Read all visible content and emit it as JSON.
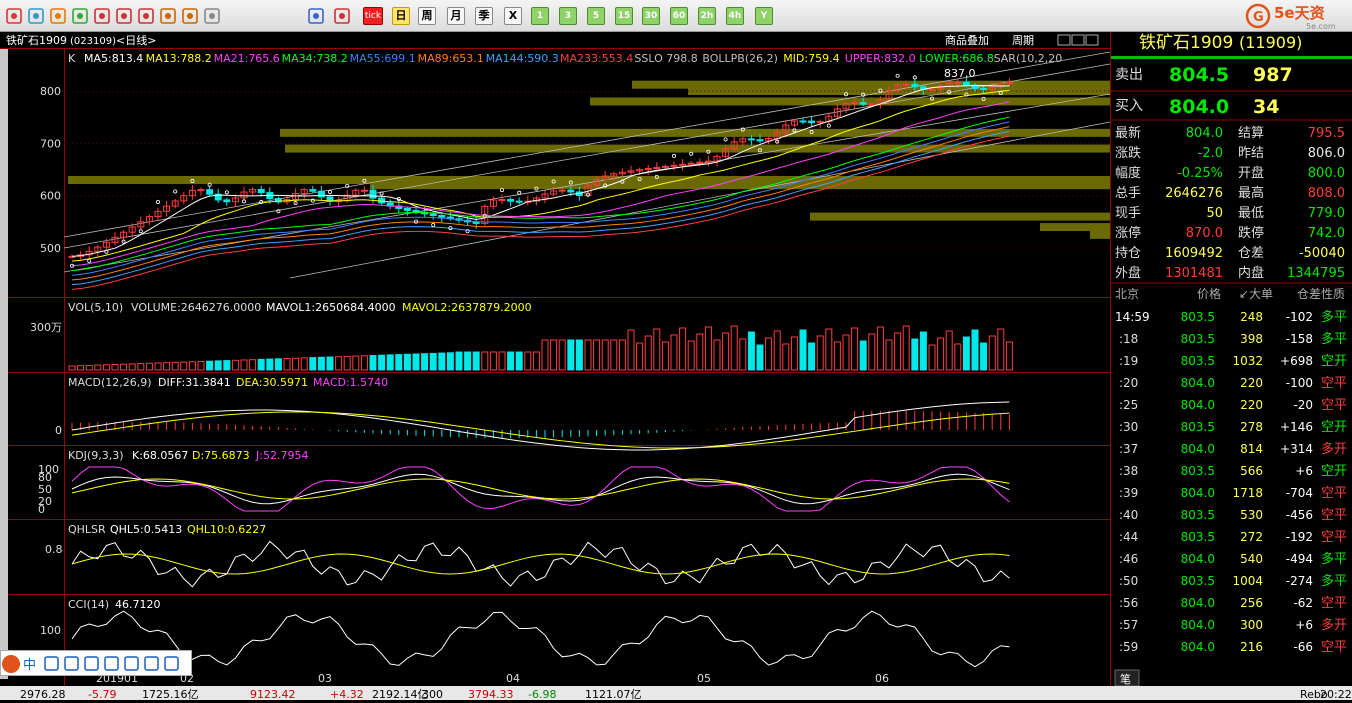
{
  "toolbar": {
    "buttons": [
      "home-icon",
      "save-icon",
      "f10-icon",
      "refresh-icon",
      "zoom-in-icon",
      "zoom-out-icon",
      "window-icon",
      "pen-icon",
      "tool-icon",
      "filter-icon",
      "table-icon",
      "chart-icon"
    ],
    "tick": "tick",
    "periods": [
      "日",
      "周",
      "月",
      "季",
      "X",
      "1",
      "3",
      "5",
      "15",
      "30",
      "60",
      "2h",
      "4h",
      "Y"
    ]
  },
  "logo": {
    "brand": "5e天资",
    "sub": "5e.com"
  },
  "title": {
    "name": "铁矿石1909",
    "code": "(023109)",
    "period": "<日线>",
    "overlay": "商品叠加",
    "cycle": "周期"
  },
  "main": {
    "k": "K",
    "ma": [
      {
        "t": "MA5:813.4",
        "c": "#ffffff"
      },
      {
        "t": "MA13:788.2",
        "c": "#ffff00"
      },
      {
        "t": "MA21:765.6",
        "c": "#ff40ff"
      },
      {
        "t": "MA34:738.2",
        "c": "#00ff00"
      },
      {
        "t": "MA55:699.1",
        "c": "#4080ff"
      },
      {
        "t": "MA89:653.1",
        "c": "#ff8000"
      },
      {
        "t": "MA144:590.3",
        "c": "#40a0ff"
      },
      {
        "t": "MA233:553.4",
        "c": "#ff4040"
      }
    ],
    "extra": [
      {
        "t": "SSLO 798.8",
        "c": "#c0c0c0"
      },
      {
        "t": "BOLLPB(26,2)",
        "c": "#c0c0c0"
      },
      {
        "t": "MID:759.4",
        "c": "#ffff00"
      },
      {
        "t": "UPPER:832.0",
        "c": "#ff40ff"
      },
      {
        "t": "LOWER:686.8",
        "c": "#00ff00"
      },
      {
        "t": "SAR(10,2,20",
        "c": "#c0c0c0"
      }
    ],
    "high_label": "837.0",
    "yticks": [
      "800",
      "700",
      "600",
      "500"
    ]
  },
  "vol": {
    "title": "VOL(5,10)",
    "v": "VOLUME:2646276.0000",
    "m1": "MAVOL1:2650684.4000",
    "m2": "MAVOL2:2637879.2000",
    "ytick": "300万"
  },
  "macd": {
    "title": "MACD(12,26,9)",
    "diff": "DIFF:31.3841",
    "dea": "DEA:30.5971",
    "macd": "MACD:1.5740",
    "ytick": "0"
  },
  "kdj": {
    "title": "KDJ(9,3,3)",
    "k": "K:68.0567",
    "d": "D:75.6873",
    "j": "J:52.7954",
    "yticks": [
      "100",
      "80",
      "50",
      "20",
      "0"
    ]
  },
  "qhlsr": {
    "title": "QHLSR",
    "a": "QHL5:0.5413",
    "b": "QHL10:0.6227",
    "ytick": "0.8"
  },
  "cci": {
    "title": "CCI(14)",
    "v": "46.7120",
    "ytick": "100"
  },
  "xaxis": [
    "201901",
    "02",
    "03",
    "04",
    "05",
    "06"
  ],
  "panel": {
    "name": "铁矿石1909",
    "code": "(11909)",
    "sell_label": "卖出",
    "sell_price": "804.5",
    "sell_vol": "987",
    "buy_label": "买入",
    "buy_price": "804.0",
    "buy_vol": "34",
    "rows": [
      [
        "最新",
        "804.0",
        "dn",
        "结算",
        "795.5",
        "up"
      ],
      [
        "涨跌",
        "-2.0",
        "dn",
        "昨结",
        "806.0",
        "wh"
      ],
      [
        "幅度",
        "-0.25%",
        "dn",
        "开盘",
        "800.0",
        "dn"
      ],
      [
        "总手",
        "2646276",
        "yl",
        "最高",
        "808.0",
        "up"
      ],
      [
        "现手",
        "50",
        "yl",
        "最低",
        "779.0",
        "dn"
      ],
      [
        "涨停",
        "870.0",
        "up",
        "跌停",
        "742.0",
        "dn"
      ],
      [
        "持仓",
        "1609492",
        "yl",
        "仓差",
        "-50040",
        "yl"
      ],
      [
        "外盘",
        "1301481",
        "up",
        "内盘",
        "1344795",
        "dn"
      ]
    ],
    "tick_hdr": [
      "北京",
      "价格",
      "↙大单",
      "仓差",
      "性质"
    ],
    "ticks": [
      [
        "14:59",
        "803.5",
        "248",
        "-102",
        "多平",
        "dn"
      ],
      [
        ":18",
        "803.5",
        "398",
        "-158",
        "多平",
        "dn"
      ],
      [
        ":19",
        "803.5",
        "1032",
        "+698",
        "空开",
        "dn"
      ],
      [
        ":20",
        "804.0",
        "220",
        "-100",
        "空平",
        "up"
      ],
      [
        ":25",
        "804.0",
        "220",
        "-20",
        "空平",
        "up"
      ],
      [
        ":30",
        "803.5",
        "278",
        "+146",
        "空开",
        "dn"
      ],
      [
        ":37",
        "804.0",
        "814",
        "+314",
        "多开",
        "up"
      ],
      [
        ":38",
        "803.5",
        "566",
        "+6",
        "空开",
        "dn"
      ],
      [
        ":39",
        "804.0",
        "1718",
        "-704",
        "空平",
        "up"
      ],
      [
        ":40",
        "803.5",
        "530",
        "-456",
        "空平",
        "up"
      ],
      [
        ":44",
        "803.5",
        "272",
        "-192",
        "空平",
        "up"
      ],
      [
        ":46",
        "804.0",
        "540",
        "-494",
        "多平",
        "dn"
      ],
      [
        ":50",
        "803.5",
        "1004",
        "-274",
        "多平",
        "dn"
      ],
      [
        ":56",
        "804.0",
        "256",
        "-62",
        "空平",
        "up"
      ],
      [
        ":57",
        "804.0",
        "300",
        "+6",
        "多开",
        "up"
      ],
      [
        ":59",
        "804.0",
        "216",
        "-66",
        "空平",
        "up"
      ]
    ],
    "tab": "笔"
  },
  "status": [
    "2976.28",
    "-5.79",
    "1725.16亿",
    "9123.42",
    "+4.32",
    "2192.14亿",
    "300",
    "3794.33",
    "-6.98",
    "1121.07亿",
    "Rebo",
    "20:22"
  ]
}
